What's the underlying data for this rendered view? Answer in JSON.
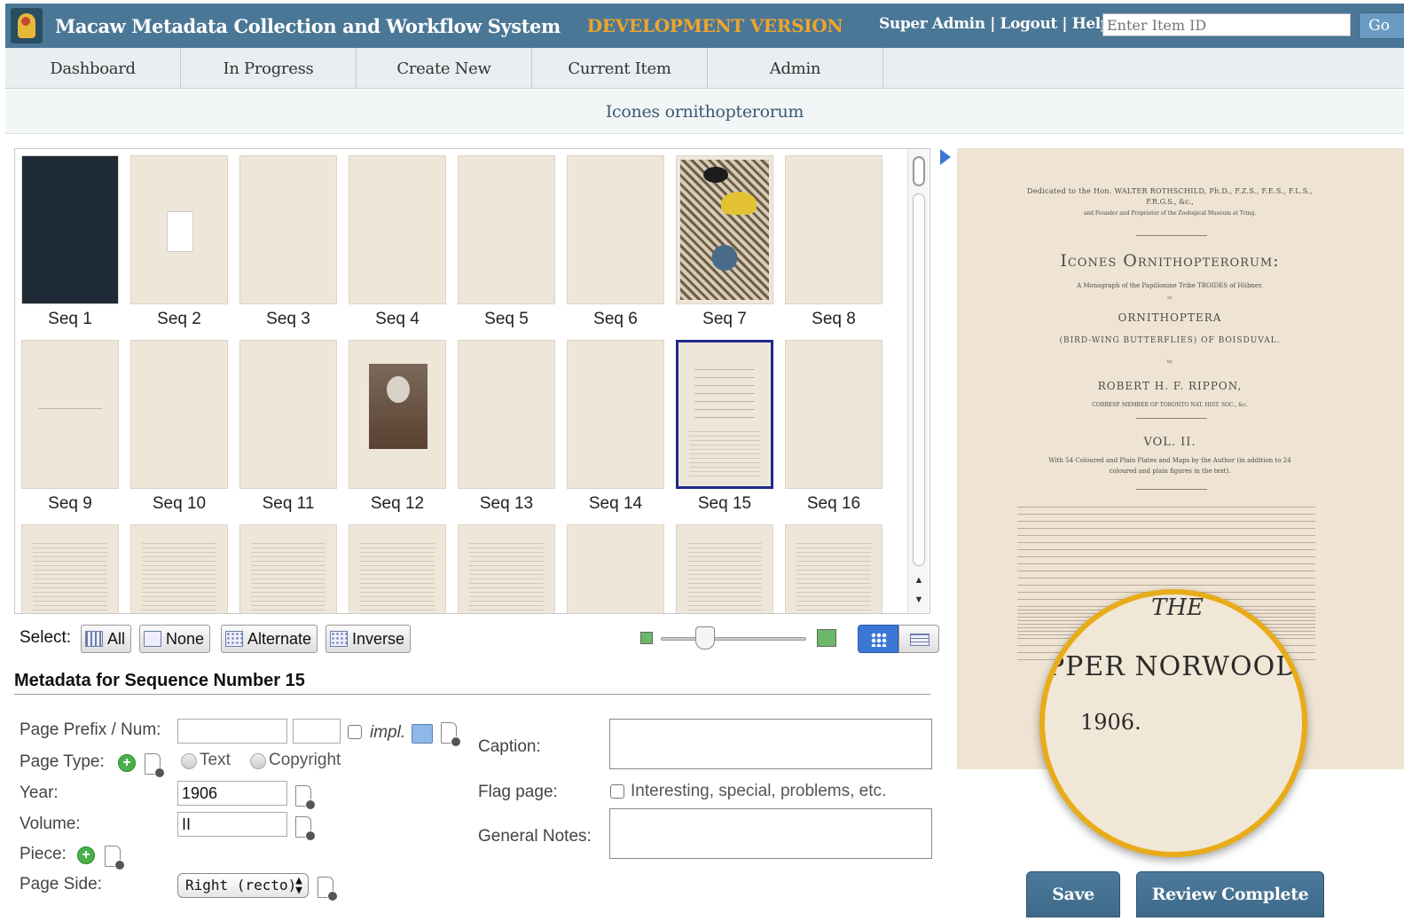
{
  "header": {
    "app_title": "Macaw Metadata Collection and Workflow System",
    "dev_version": "DEVELOPMENT VERSION",
    "user_name": "Super Admin",
    "separator": " | ",
    "logout": "Logout",
    "help": "Help",
    "item_id_placeholder": "Enter Item ID",
    "go_label": "Go"
  },
  "nav": {
    "tabs": [
      {
        "label": "Dashboard"
      },
      {
        "label": "In Progress"
      },
      {
        "label": "Create New"
      },
      {
        "label": "Current Item"
      },
      {
        "label": "Admin"
      }
    ]
  },
  "item": {
    "title": "Icones ornithopterorum"
  },
  "thumbnails": [
    {
      "label": "Seq 1",
      "style": "dark"
    },
    {
      "label": "Seq 2",
      "style": "card"
    },
    {
      "label": "Seq 3",
      "style": "blank"
    },
    {
      "label": "Seq 4",
      "style": "blank"
    },
    {
      "label": "Seq 5",
      "style": "blank"
    },
    {
      "label": "Seq 6",
      "style": "blank"
    },
    {
      "label": "Seq 7",
      "style": "decor"
    },
    {
      "label": "Seq 8",
      "style": "blank"
    },
    {
      "label": "Seq 9",
      "style": "halftitle"
    },
    {
      "label": "Seq 10",
      "style": "blank"
    },
    {
      "label": "Seq 11",
      "style": "blank"
    },
    {
      "label": "Seq 12",
      "style": "portrait"
    },
    {
      "label": "Seq 13",
      "style": "blank"
    },
    {
      "label": "Seq 14",
      "style": "blank"
    },
    {
      "label": "Seq 15",
      "style": "title",
      "selected": true
    },
    {
      "label": "Seq 16",
      "style": "blank"
    },
    {
      "label": "",
      "style": "text"
    },
    {
      "label": "",
      "style": "text"
    },
    {
      "label": "",
      "style": "text"
    },
    {
      "label": "",
      "style": "text"
    },
    {
      "label": "",
      "style": "text"
    },
    {
      "label": "",
      "style": "blank"
    },
    {
      "label": "",
      "style": "text"
    },
    {
      "label": "",
      "style": "text"
    }
  ],
  "selection": {
    "label": "Select:",
    "all": "All",
    "none": "None",
    "alternate": "Alternate",
    "inverse": "Inverse"
  },
  "metadata": {
    "heading": "Metadata for Sequence Number 15",
    "page_prefix_label": "Page Prefix / Num:",
    "page_prefix_value": "",
    "page_num_value": "",
    "impl_label": "impl.",
    "page_type_label": "Page Type:",
    "page_type_options": [
      "Text",
      "Copyright"
    ],
    "year_label": "Year:",
    "year_value": "1906",
    "volume_label": "Volume:",
    "volume_value": "II",
    "piece_label": "Piece:",
    "page_side_label": "Page Side:",
    "page_side_value": "Right (recto)",
    "caption_label": "Caption:",
    "caption_value": "",
    "flag_label": "Flag page:",
    "flag_text": "Interesting, special, problems, etc.",
    "notes_label": "General Notes:",
    "notes_value": ""
  },
  "preview": {
    "dedication": "Dedicated to the Hon. WALTER ROTHSCHILD, Ph.D., F.Z.S., F.E.S., F.L.S.,",
    "dedication2": "F.R.G.S., &c.,",
    "dedication3": "and Founder and Proprietor of the Zoological Museum at Tring.",
    "title": "Icones Ornithopterorum:",
    "subtitle": "A Monograph of the Papilionine Tribe TROIDES of Hübner.",
    "or": "or",
    "ornithoptera": "ORNITHOPTERA",
    "birdwing": "(BIRD-WING BUTTERFLIES) OF BOISDUVAL.",
    "by": "by",
    "author": "ROBERT H. F. RIPPON,",
    "author_member": "CORRESP. MEMBER OF TORONTO NAT. HIST. SOC., &c.",
    "vol": "VOL. II.",
    "plates": "With 54 Coloured and Plain Plates and Maps by the Author (in addition to 24",
    "plates2": "coloured and plain figures in the text).",
    "mag_the": "THE",
    "mag_norwood": "PPER NORWOOD",
    "mag_year": "1906."
  },
  "actions": {
    "save": "Save",
    "review_complete": "Review Complete"
  }
}
